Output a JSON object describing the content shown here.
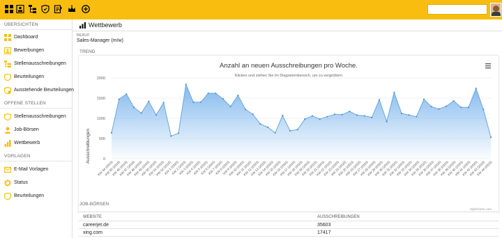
{
  "topbar": {
    "icons": [
      "dashboard-icon",
      "profile-card-icon",
      "org-chart-icon",
      "shield-icon",
      "clipboard-icon",
      "crown-icon",
      "add-circle-icon"
    ],
    "search_value": "",
    "colors": {
      "background": "#f9bd0f"
    }
  },
  "sidebar": {
    "sections": [
      {
        "title": "ÜBERSICHTEN",
        "items": [
          {
            "label": "Dashboard",
            "icon": "dashboard-icon"
          },
          {
            "label": "Bewerbungen",
            "icon": "application-icon"
          },
          {
            "label": "Stellenausschreibungen",
            "icon": "job-posting-icon"
          },
          {
            "label": "Beurteilungen",
            "icon": "shield-icon"
          },
          {
            "label": "Ausstehende Beurteilungen",
            "icon": "pending-review-icon"
          }
        ]
      },
      {
        "title": "OFFENE STELLEN",
        "items": [
          {
            "label": "Stellenausschreibungen",
            "icon": "job-posting-icon"
          },
          {
            "label": "Job-Börsen",
            "icon": "user-icon"
          },
          {
            "label": "Wettbewerb",
            "icon": "bar-chart-icon"
          }
        ]
      },
      {
        "title": "VORLAGEN",
        "items": [
          {
            "label": "E-Mail Vorlagen",
            "icon": "email-icon"
          },
          {
            "label": "Status",
            "icon": "gear-icon"
          },
          {
            "label": "Beurteilungen",
            "icon": "shield-icon"
          }
        ]
      }
    ],
    "icon_color": "#f9bd0f"
  },
  "main": {
    "title": "Wettbewerb",
    "beruf_label": "BERUF",
    "beruf_value": "Sales-Manager (m/w)",
    "trend_label": "TREND",
    "jobboards_label": "JOB-BÖRSEN",
    "table": {
      "headers": [
        "WEBSITE",
        "AUSSCHREIBUNGEN"
      ],
      "rows": [
        [
          "careerjet.de",
          "35603"
        ],
        [
          "xing.com",
          "17417"
        ]
      ]
    }
  },
  "chart_data": {
    "type": "area",
    "title": "Anzahl an neuen Ausschreibungen pro Woche.",
    "subtitle": "Klicken und ziehen Sie im Diagrammbereich, um zu vergrößern",
    "xlabel": "",
    "ylabel": "Ausschreibungen",
    "ylim": [
      0,
      2000
    ],
    "yticks": [
      0,
      500,
      1000,
      1500,
      2000
    ],
    "grid": true,
    "legend": "none",
    "credits": "Highcharts.com",
    "color": "#7cb5ec",
    "categories": [
      "KW 44 (2019)",
      "KW 45 (2019)",
      "KW 46 (2019)",
      "KW 47 (2019)",
      "KW 48 (2019)",
      "KW 49 (2019)",
      "KW 50 (2019)",
      "KW 51 (2019)",
      "KW 52 (2019)",
      "KW 1 (2020)",
      "KW 2 (2020)",
      "KW 3 (2020)",
      "KW 4 (2020)",
      "KW 5 (2020)",
      "KW 6 (2020)",
      "KW 7 (2020)",
      "KW 8 (2020)",
      "KW 9 (2020)",
      "KW 10 (2020)",
      "KW 11 (2020)",
      "KW 12 (2020)",
      "KW 13 (2020)",
      "KW 14 (2020)",
      "KW 15 (2020)",
      "KW 16 (2020)",
      "KW 17 (2020)",
      "KW 18 (2020)",
      "KW 19 (2020)",
      "KW 20 (2020)",
      "KW 21 (2020)",
      "KW 22 (2020)",
      "KW 23 (2020)",
      "KW 24 (2020)",
      "KW 25 (2020)",
      "KW 26 (2020)",
      "KW 27 (2020)",
      "KW 28 (2020)",
      "KW 29 (2020)",
      "KW 30 (2020)",
      "KW 31 (2020)",
      "KW 32 (2020)",
      "KW 33 (2020)",
      "KW 34 (2020)",
      "KW 35 (2020)",
      "KW 36 (2020)",
      "KW 37 (2020)",
      "KW 38 (2020)",
      "KW 39 (2020)",
      "KW 40 (2020)",
      "KW 41 (2020)",
      "KW 42 (2020)",
      "KW 43 (2020)",
      "KW 44 (2020)"
    ],
    "values": [
      640,
      1470,
      1600,
      1270,
      1130,
      1420,
      1080,
      1390,
      560,
      630,
      1840,
      1400,
      1400,
      1620,
      1620,
      1480,
      1290,
      1570,
      1220,
      1100,
      860,
      780,
      640,
      1070,
      690,
      720,
      980,
      1060,
      980,
      1040,
      1100,
      1090,
      1170,
      1080,
      1060,
      1020,
      1460,
      920,
      1640,
      1120,
      1080,
      1040,
      1470,
      1290,
      1230,
      1300,
      1430,
      1270,
      1270,
      1740,
      1220,
      530
    ]
  }
}
